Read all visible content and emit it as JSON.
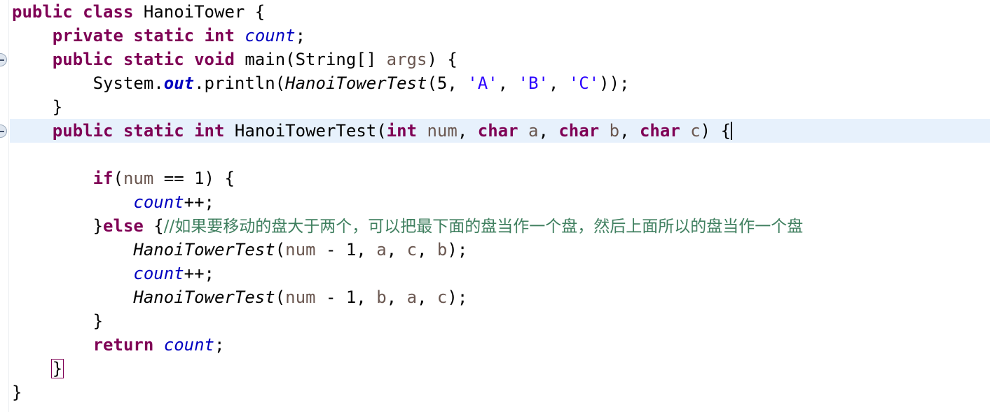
{
  "editor": {
    "language": "java",
    "colors": {
      "keyword": "#7f0055",
      "field": "#0000c0",
      "parameter": "#6a5750",
      "string": "#2a00ff",
      "comment": "#3f7f5f",
      "plain": "#000000",
      "current_line_background": "#e7f1fc",
      "bracket_match_border": "#7f0055",
      "background": "#ffffff"
    },
    "gutter": {
      "fold_markers": [
        {
          "icon": "fold-collapse-icon",
          "line": 3
        },
        {
          "icon": "fold-collapse-icon",
          "line": 6
        }
      ]
    },
    "current_line": 6,
    "caret_line": 6
  },
  "lines": [
    {
      "n": 1,
      "tokens": [
        {
          "t": "public",
          "c": "kw"
        },
        {
          "t": " ",
          "c": "plain"
        },
        {
          "t": "class",
          "c": "kw"
        },
        {
          "t": " ",
          "c": "plain"
        },
        {
          "t": "HanoiTower",
          "c": "plain"
        },
        {
          "t": " {",
          "c": "plain"
        }
      ]
    },
    {
      "n": 2,
      "tokens": [
        {
          "t": "    ",
          "c": "plain"
        },
        {
          "t": "private",
          "c": "kw"
        },
        {
          "t": " ",
          "c": "plain"
        },
        {
          "t": "static",
          "c": "kw"
        },
        {
          "t": " ",
          "c": "plain"
        },
        {
          "t": "int",
          "c": "kw"
        },
        {
          "t": " ",
          "c": "plain"
        },
        {
          "t": "count",
          "c": "field"
        },
        {
          "t": ";",
          "c": "plain"
        }
      ]
    },
    {
      "n": 3,
      "tokens": [
        {
          "t": "    ",
          "c": "plain"
        },
        {
          "t": "public",
          "c": "kw"
        },
        {
          "t": " ",
          "c": "plain"
        },
        {
          "t": "static",
          "c": "kw"
        },
        {
          "t": " ",
          "c": "plain"
        },
        {
          "t": "void",
          "c": "kw"
        },
        {
          "t": " ",
          "c": "plain"
        },
        {
          "t": "main(String[] ",
          "c": "plain"
        },
        {
          "t": "args",
          "c": "param"
        },
        {
          "t": ") {",
          "c": "plain"
        }
      ]
    },
    {
      "n": 4,
      "tokens": [
        {
          "t": "        ",
          "c": "plain"
        },
        {
          "t": "System.",
          "c": "plain"
        },
        {
          "t": "out",
          "c": "sfield"
        },
        {
          "t": ".println(",
          "c": "plain"
        },
        {
          "t": "HanoiTowerTest",
          "c": "smethod"
        },
        {
          "t": "(5, ",
          "c": "plain"
        },
        {
          "t": "'A'",
          "c": "str"
        },
        {
          "t": ", ",
          "c": "plain"
        },
        {
          "t": "'B'",
          "c": "str"
        },
        {
          "t": ", ",
          "c": "plain"
        },
        {
          "t": "'C'",
          "c": "str"
        },
        {
          "t": "));",
          "c": "plain"
        }
      ]
    },
    {
      "n": 5,
      "tokens": [
        {
          "t": "    }",
          "c": "plain"
        }
      ]
    },
    {
      "n": 6,
      "current": true,
      "caret": true,
      "tokens": [
        {
          "t": "    ",
          "c": "plain"
        },
        {
          "t": "public",
          "c": "kw"
        },
        {
          "t": " ",
          "c": "plain"
        },
        {
          "t": "static",
          "c": "kw"
        },
        {
          "t": " ",
          "c": "plain"
        },
        {
          "t": "int",
          "c": "kw"
        },
        {
          "t": " ",
          "c": "plain"
        },
        {
          "t": "HanoiTowerTest(",
          "c": "plain"
        },
        {
          "t": "int",
          "c": "kw"
        },
        {
          "t": " ",
          "c": "plain"
        },
        {
          "t": "num",
          "c": "param"
        },
        {
          "t": ", ",
          "c": "plain"
        },
        {
          "t": "char",
          "c": "kw"
        },
        {
          "t": " ",
          "c": "plain"
        },
        {
          "t": "a",
          "c": "param"
        },
        {
          "t": ", ",
          "c": "plain"
        },
        {
          "t": "char",
          "c": "kw"
        },
        {
          "t": " ",
          "c": "plain"
        },
        {
          "t": "b",
          "c": "param"
        },
        {
          "t": ", ",
          "c": "plain"
        },
        {
          "t": "char",
          "c": "kw"
        },
        {
          "t": " ",
          "c": "plain"
        },
        {
          "t": "c",
          "c": "param"
        },
        {
          "t": ") {",
          "c": "plain"
        }
      ]
    },
    {
      "n": 7,
      "tokens": []
    },
    {
      "n": 8,
      "tokens": [
        {
          "t": "        ",
          "c": "plain"
        },
        {
          "t": "if",
          "c": "kw"
        },
        {
          "t": "(",
          "c": "plain"
        },
        {
          "t": "num",
          "c": "param"
        },
        {
          "t": " == 1) {",
          "c": "plain"
        }
      ]
    },
    {
      "n": 9,
      "tokens": [
        {
          "t": "            ",
          "c": "plain"
        },
        {
          "t": "count",
          "c": "field"
        },
        {
          "t": "++;",
          "c": "plain"
        }
      ]
    },
    {
      "n": 10,
      "tokens": [
        {
          "t": "        }",
          "c": "plain"
        },
        {
          "t": "else",
          "c": "kw"
        },
        {
          "t": " {",
          "c": "plain"
        },
        {
          "t": "//如果要移动的盘大于两个，可以把最下面的盘当作一个盘，然后上面所以的盘当作一个盘",
          "c": "cmt"
        }
      ]
    },
    {
      "n": 11,
      "tokens": [
        {
          "t": "            ",
          "c": "plain"
        },
        {
          "t": "HanoiTowerTest",
          "c": "smethod"
        },
        {
          "t": "(",
          "c": "plain"
        },
        {
          "t": "num",
          "c": "param"
        },
        {
          "t": " - 1, ",
          "c": "plain"
        },
        {
          "t": "a",
          "c": "param"
        },
        {
          "t": ", ",
          "c": "plain"
        },
        {
          "t": "c",
          "c": "param"
        },
        {
          "t": ", ",
          "c": "plain"
        },
        {
          "t": "b",
          "c": "param"
        },
        {
          "t": ");",
          "c": "plain"
        }
      ]
    },
    {
      "n": 12,
      "tokens": [
        {
          "t": "            ",
          "c": "plain"
        },
        {
          "t": "count",
          "c": "field"
        },
        {
          "t": "++;",
          "c": "plain"
        }
      ]
    },
    {
      "n": 13,
      "tokens": [
        {
          "t": "            ",
          "c": "plain"
        },
        {
          "t": "HanoiTowerTest",
          "c": "smethod"
        },
        {
          "t": "(",
          "c": "plain"
        },
        {
          "t": "num",
          "c": "param"
        },
        {
          "t": " - 1, ",
          "c": "plain"
        },
        {
          "t": "b",
          "c": "param"
        },
        {
          "t": ", ",
          "c": "plain"
        },
        {
          "t": "a",
          "c": "param"
        },
        {
          "t": ", ",
          "c": "plain"
        },
        {
          "t": "c",
          "c": "param"
        },
        {
          "t": ");",
          "c": "plain"
        }
      ]
    },
    {
      "n": 14,
      "tokens": [
        {
          "t": "        }",
          "c": "plain"
        }
      ]
    },
    {
      "n": 15,
      "tokens": [
        {
          "t": "        ",
          "c": "plain"
        },
        {
          "t": "return",
          "c": "kw"
        },
        {
          "t": " ",
          "c": "plain"
        },
        {
          "t": "count",
          "c": "field"
        },
        {
          "t": ";",
          "c": "plain"
        }
      ]
    },
    {
      "n": 16,
      "tokens": [
        {
          "t": "    ",
          "c": "plain"
        },
        {
          "t": "}",
          "c": "plain",
          "bracket_match": true
        }
      ]
    },
    {
      "n": 17,
      "tokens": [
        {
          "t": "}",
          "c": "plain"
        }
      ]
    }
  ]
}
